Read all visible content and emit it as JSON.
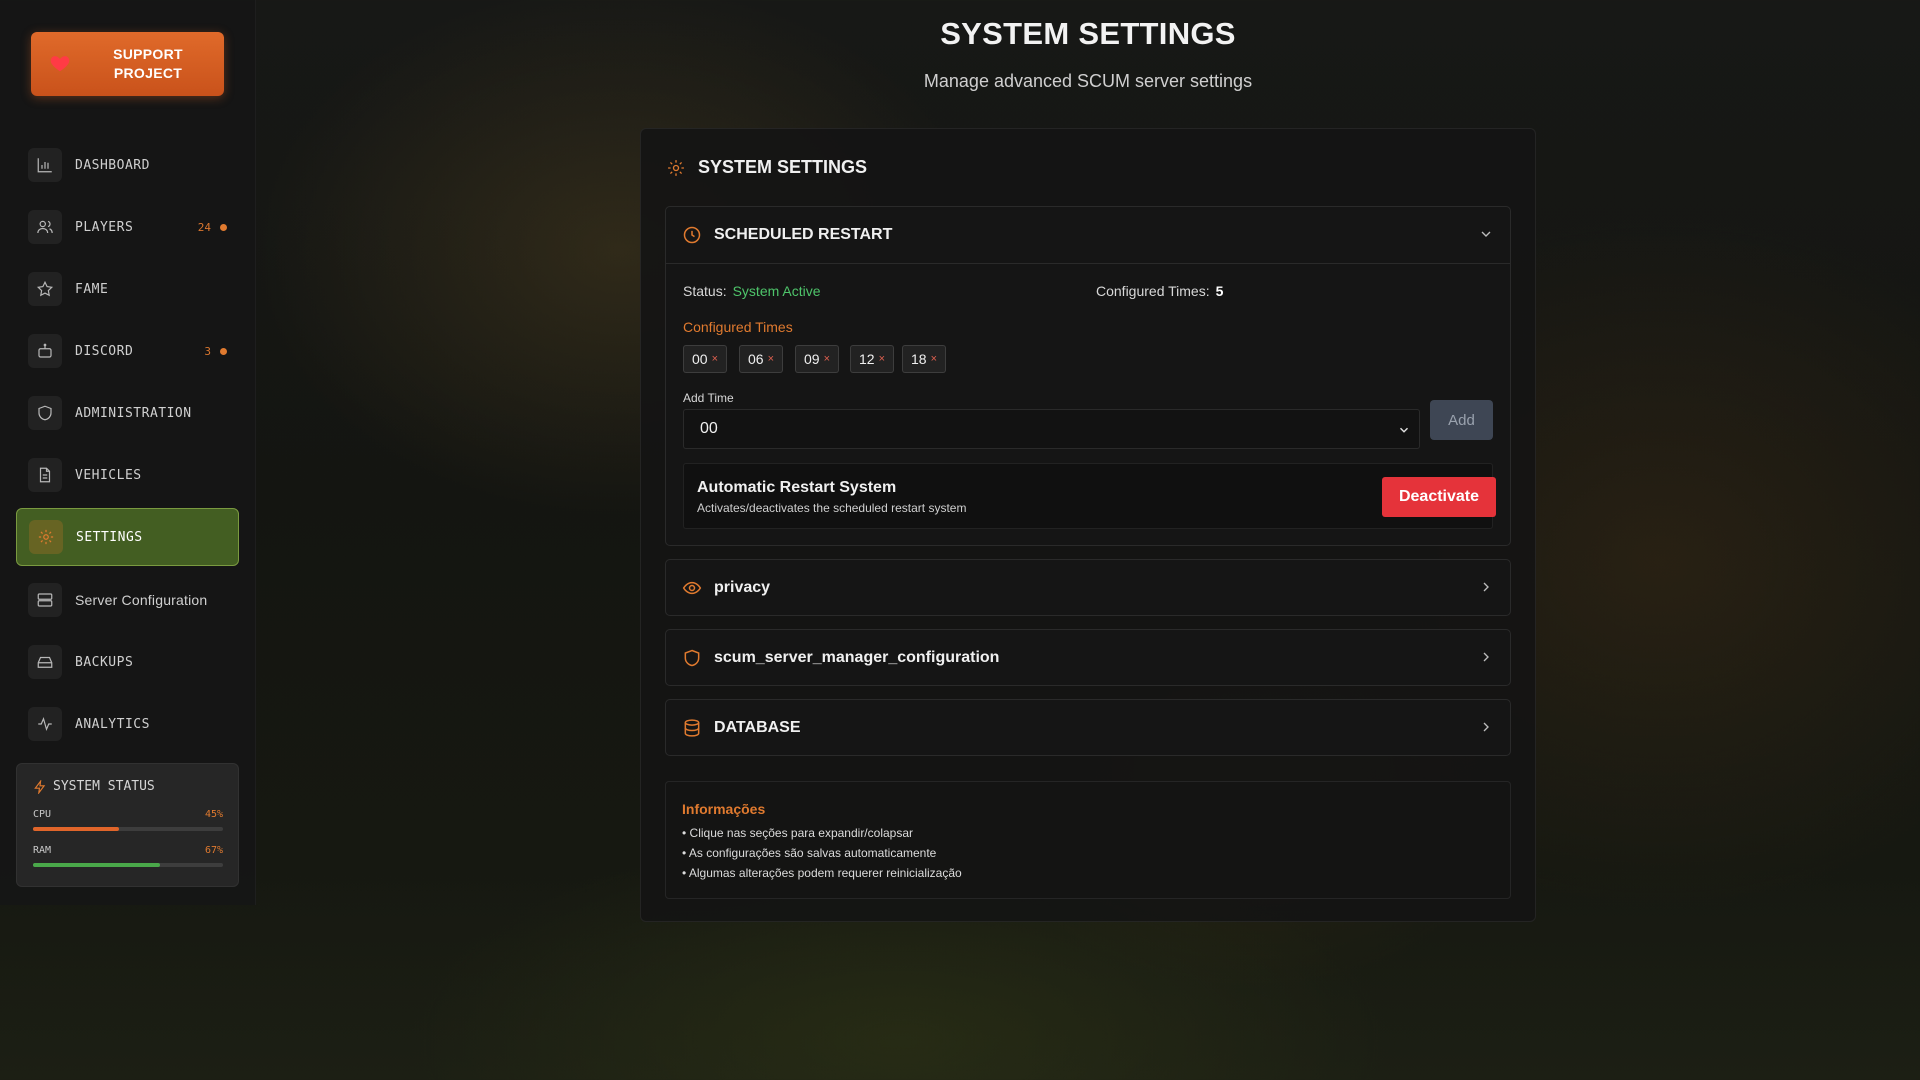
{
  "sidebar": {
    "support_label": "SUPPORT PROJECT",
    "items": [
      {
        "label": "DASHBOARD"
      },
      {
        "label": "PLAYERS",
        "badge": "24"
      },
      {
        "label": "FAME"
      },
      {
        "label": "DISCORD",
        "badge": "3"
      },
      {
        "label": "ADMINISTRATION"
      },
      {
        "label": "VEHICLES"
      },
      {
        "label": "SETTINGS"
      },
      {
        "label": "Server Configuration"
      },
      {
        "label": "BACKUPS"
      },
      {
        "label": "ANALYTICS"
      }
    ],
    "active_item": "SETTINGS",
    "system_status": {
      "title": "SYSTEM STATUS",
      "cpu": {
        "label": "CPU",
        "value": "45%",
        "fraction": 0.45,
        "color": "#e0652a"
      },
      "ram": {
        "label": "RAM",
        "value": "67%",
        "fraction": 0.67,
        "color": "#4aa84a"
      }
    }
  },
  "header": {
    "title": "SYSTEM SETTINGS",
    "subtitle": "Manage advanced SCUM server settings"
  },
  "card": {
    "title": "SYSTEM SETTINGS",
    "scheduled_restart": {
      "title": "SCHEDULED RESTART",
      "status_label": "Status:",
      "status_value": "System Active",
      "configured_label": "Configured Times:",
      "configured_count": "5",
      "configured_times_title": "Configured Times",
      "times": [
        "00",
        "06",
        "09",
        "12",
        "18"
      ],
      "remove_symbol": "×",
      "add_time_label": "Add Time",
      "add_time_value": "00",
      "add_button": "Add",
      "auto_title": "Automatic Restart System",
      "auto_desc": "Activates/deactivates the scheduled restart system",
      "deactivate_button": "Deactivate"
    },
    "sections": [
      {
        "title": "privacy",
        "icon": "eye-icon"
      },
      {
        "title": "scum_server_manager_configuration",
        "icon": "shield-icon"
      },
      {
        "title": "DATABASE",
        "icon": "database-icon"
      }
    ],
    "info": {
      "title": "Informações",
      "items": [
        "• Clique nas seções para expandir/colapsar",
        "• As configurações são salvas automaticamente",
        "• Algumas alterações podem requerer reinicialização"
      ]
    }
  },
  "colors": {
    "accent": "#e07a2f",
    "active_nav_bg": "#435e22",
    "status_active": "#4ec46a",
    "deactivate_bg": "#e5333a"
  }
}
